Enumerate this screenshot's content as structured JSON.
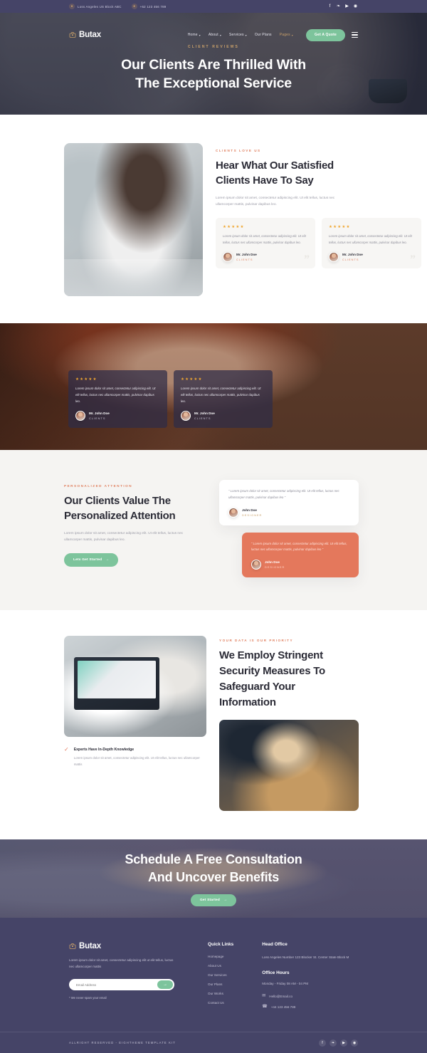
{
  "topbar": {
    "address": "Loss Angeles US Block ABC",
    "phone": "+62 123 456 789",
    "location_icon": "map-pin-icon",
    "phone_icon": "phone-icon",
    "socials": [
      "facebook-icon",
      "twitter-icon",
      "youtube-icon",
      "instagram-icon"
    ],
    "social_glyphs": [
      "f",
      "❧",
      "▶",
      "◉"
    ]
  },
  "nav": {
    "brand": "Butax",
    "links": [
      {
        "label": "Home",
        "caret": "▾",
        "active": false
      },
      {
        "label": "About",
        "caret": "▾",
        "active": false
      },
      {
        "label": "Services",
        "caret": "▾",
        "active": false
      },
      {
        "label": "Our Plans",
        "caret": "",
        "active": false
      },
      {
        "label": "Pages",
        "caret": "▾",
        "active": true
      }
    ],
    "quote_button": "Get A Quote"
  },
  "hero": {
    "eyebrow": "CLIENT REVIEWS",
    "title_line1": "Our Clients Are Thrilled With",
    "title_line2": "The Exceptional Service"
  },
  "love": {
    "eyebrow": "CLIENTS LOVE US",
    "title_line1": "Hear What Our Satisfied",
    "title_line2": "Clients Have To Say",
    "body": "Lorem ipsum dolor sit amet, consectetur adipiscing elit. Ut elit tellus, luctus nec ullamcorper mattis, pulvinar dapibus leo.",
    "cards": [
      {
        "stars": "★★★★★",
        "quote": "Lorem ipsum dolor sit amet, consectetur adipiscing elit. Ut elit tellus, luctus nec ullamcorper mattis, pulvinar dapibus leo.",
        "name": "Mr. John Doe",
        "role": "CLIENTS",
        "quote_mark": "”"
      },
      {
        "stars": "★★★★★",
        "quote": "Lorem ipsum dolor sit amet, consectetur adipiscing elit. Ut elit tellus, luctus nec ullamcorper mattis, pulvinar dapibus leo.",
        "name": "Mr. John Doe",
        "role": "CLIENTS",
        "quote_mark": "”"
      }
    ]
  },
  "band": {
    "cards": [
      {
        "stars": "★★★★★",
        "quote": "Lorem ipsum dolor sit amet, consectetur adipiscing elit. Ut elit tellus, luctus nec ullamcorper mattis, pulvinar dapibus leo.",
        "name": "Mr. John Doe",
        "role": "CLIENTS"
      },
      {
        "stars": "★★★★★",
        "quote": "Lorem ipsum dolor sit amet, consectetur adipiscing elit. Ut elit tellus, luctus nec ullamcorper mattis, pulvinar dapibus leo.",
        "name": "Mr. John Doe",
        "role": "CLIENTS"
      }
    ]
  },
  "personalized": {
    "eyebrow": "PERSONALIZED ATTENTION",
    "title_line1": "Our Clients Value The",
    "title_line2": "Personalized Attention",
    "body": "Lorem ipsum dolor sit amet, consectetur adipiscing elit. Ut elit tellus, luctus nec ullamcorper mattis, pulvinar dapibus leo.",
    "button": "Lets Get Started",
    "button_arrow": "→",
    "cards": [
      {
        "quote": "“ Lorem ipsum dolor sit amet, consectetur adipiscing elit. Ut elit tellus, luctus nec ullamcorper mattis, pulvinar dapibus leo ”",
        "name": "John Doe",
        "role": "DESIGNER"
      },
      {
        "quote": "“ Lorem ipsum dolor sit amet, consectetur adipiscing elit. Ut elit tellus, luctus nec ullamcorper mattis, pulvinar dapibus leo ”",
        "name": "John Doe",
        "role": "DESIGNER"
      }
    ]
  },
  "security": {
    "eyebrow": "YOUR DATA IS OUR PRIORITY",
    "title_line1": "We Employ Stringent",
    "title_line2": "Security Measures To",
    "title_line3": "Safeguard Your Information",
    "feature": {
      "check_icon": "check-icon",
      "check_glyph": "✓",
      "title": "Experts Have In-Depth Knowledge",
      "body": "Lorem ipsum dolor sit amet, consectetur adipiscing elit. Ut elit tellus, luctus nec ullamcorper mattis"
    }
  },
  "cta": {
    "title_line1": "Schedule A Free Consultation",
    "title_line2": "And Uncover Benefits",
    "button": "Get Started",
    "button_arrow": "→"
  },
  "footer": {
    "brand": "Butax",
    "description": "Lorem ipsum dolor sit amet, consectetur adipiscing elit ut elit tellus, luctus nec ullamcorper mattis",
    "email_placeholder": "Email Address",
    "email_value": "",
    "submit_arrow": "→",
    "spam_note": "* We never spam your email",
    "quick_links_title": "Quick Links",
    "quick_links": [
      "Homepage",
      "About Us",
      "Our Services",
      "Our Plans",
      "Our Works",
      "Contact Us"
    ],
    "head_office_title": "Head Office",
    "head_office_address": "Loss Angeles Number 123 Blocker St. Center State Block M",
    "office_hours_title": "Office Hours",
    "office_hours": "Monday - Friday 08 AM - 04 PM",
    "email_icon": "mail-icon",
    "email": "Hello@Email.co",
    "phone_icon": "phone-icon",
    "phone": "+44 123 456 789",
    "copyright": "ALLRIGHT RESERVED - EIGHTHEME TEMPLATE KIT",
    "socials": [
      "facebook-icon",
      "twitter-icon",
      "youtube-icon",
      "instagram-icon"
    ],
    "social_glyphs": [
      "f",
      "❧",
      "▶",
      "◉"
    ]
  },
  "colors": {
    "brand_purple": "#454467",
    "accent_green": "#7dc49c",
    "accent_coral": "#e4785c",
    "accent_gold": "#c9a06a",
    "star_gold": "#f0a732"
  }
}
